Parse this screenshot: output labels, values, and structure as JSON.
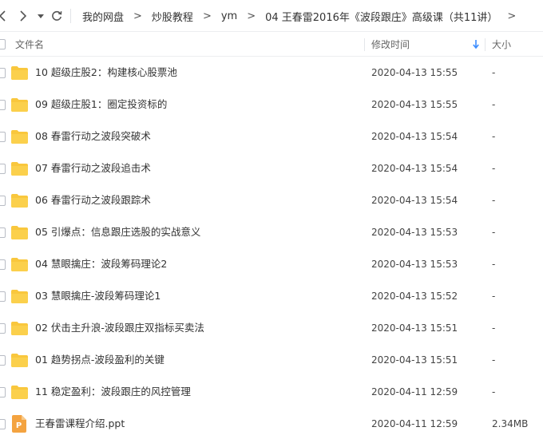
{
  "nav": {
    "icons": [
      "back-chevron-icon",
      "forward-chevron-icon",
      "history-dropdown-icon",
      "refresh-icon"
    ],
    "breadcrumb": [
      "我的网盘",
      "炒股教程",
      "ym",
      "04 王春雷2016年《波段跟庄》高级课（共11讲）"
    ]
  },
  "header": {
    "name_label": "文件名",
    "time_label": "修改时间",
    "size_label": "大小",
    "sort_icon": "sort-down-arrow-icon"
  },
  "colors": {
    "folder": "#f9c73d",
    "ppt": "#f4a340",
    "sort_accent": "#3b8cff"
  },
  "files": [
    {
      "name": "10 超级庄股2：构建核心股票池",
      "modified": "2020-04-13 15:55",
      "size": "-",
      "type": "folder"
    },
    {
      "name": "09 超级庄股1：圈定投资标的",
      "modified": "2020-04-13 15:55",
      "size": "-",
      "type": "folder"
    },
    {
      "name": "08 春雷行动之波段突破术",
      "modified": "2020-04-13 15:54",
      "size": "-",
      "type": "folder"
    },
    {
      "name": "07 春雷行动之波段追击术",
      "modified": "2020-04-13 15:54",
      "size": "-",
      "type": "folder"
    },
    {
      "name": "06 春雷行动之波段跟踪术",
      "modified": "2020-04-13 15:54",
      "size": "-",
      "type": "folder"
    },
    {
      "name": "05 引爆点：信息跟庄选股的实战意义",
      "modified": "2020-04-13 15:53",
      "size": "-",
      "type": "folder"
    },
    {
      "name": "04 慧眼擒庄：波段筹码理论2",
      "modified": "2020-04-13 15:53",
      "size": "-",
      "type": "folder"
    },
    {
      "name": "03 慧眼擒庄-波段筹码理论1",
      "modified": "2020-04-13 15:52",
      "size": "-",
      "type": "folder"
    },
    {
      "name": "02 伏击主升浪-波段跟庄双指标买卖法",
      "modified": "2020-04-13 15:51",
      "size": "-",
      "type": "folder"
    },
    {
      "name": "01 趋势拐点-波段盈利的关键",
      "modified": "2020-04-13 15:51",
      "size": "-",
      "type": "folder"
    },
    {
      "name": "11 稳定盈利：波段跟庄的风控管理",
      "modified": "2020-04-11 12:59",
      "size": "-",
      "type": "folder"
    },
    {
      "name": "王春雷课程介绍.ppt",
      "modified": "2020-04-11 12:59",
      "size": "2.34MB",
      "type": "ppt",
      "icon_letter": "P"
    }
  ]
}
